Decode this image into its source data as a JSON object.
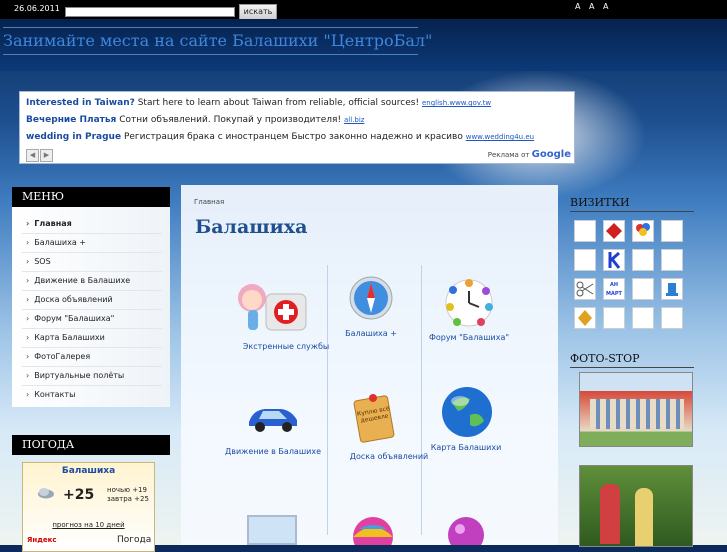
{
  "topbar": {
    "date": "26.06.2011",
    "search_placeholder": "",
    "search_button": "искать",
    "font_sizes": "A A A"
  },
  "header": {
    "site_title": "Занимайте места на сайте Балашихи \"ЦентроБал\""
  },
  "ads": {
    "items": [
      {
        "title": "Interested in Taiwan?",
        "text": "Start here to learn about Taiwan from reliable, official sources!",
        "url": "english.www.gov.tw"
      },
      {
        "title": "Вечерние Платья",
        "text": "Сотни объявлений. Покупай у производителя!",
        "url": "all.biz"
      },
      {
        "title": "wedding in Prague",
        "text": "Регистрация брака с иностранцем Быстро законно надежно и красиво",
        "url": "www.wedding4u.eu"
      }
    ],
    "google_label": "Реклама от",
    "google_brand": "Google"
  },
  "menu": {
    "title": "МЕНЮ",
    "items": [
      "Главная",
      "Балашиха +",
      "SOS",
      "Движение в Балашихе",
      "Доска объявлений",
      "Форум \"Балашиха\"",
      "Карта Балашихи",
      "ФотоГалерея",
      "Виртуальные полёты",
      "Контакты"
    ]
  },
  "weather": {
    "title": "ПОГОДА",
    "city": "Балашиха",
    "temp": "+25",
    "night": "ночью +19",
    "tomorrow": "завтра +25",
    "forecast_link": "прогноз на 10 дней",
    "provider": "Яндекс",
    "provider_label": "Погода"
  },
  "main": {
    "breadcrumb": "Главная",
    "title": "Балашиха",
    "tiles": [
      {
        "label": "Экстренные службы",
        "icon": "first-aid-icon"
      },
      {
        "label": "Балашиха +",
        "icon": "compass-icon"
      },
      {
        "label": "Форум \"Балашиха\"",
        "icon": "clock-icon"
      },
      {
        "label": "Движение в Балашихе",
        "icon": "car-icon"
      },
      {
        "label": "Доска объявлений",
        "icon": "note-icon"
      },
      {
        "label": "Карта Балашихи",
        "icon": "globe-icon"
      }
    ],
    "note_text": "Куплю всё дешевле"
  },
  "right": {
    "vizitki_title": "ВИЗИТКИ",
    "photostop_title": "ФОТО-STOP",
    "card_labels": [
      "АН МАРТ"
    ]
  },
  "colors": {
    "accent": "#1f4f8c",
    "link": "#1c4ba0",
    "topbar": "#000000",
    "header": "#0c3a78"
  }
}
